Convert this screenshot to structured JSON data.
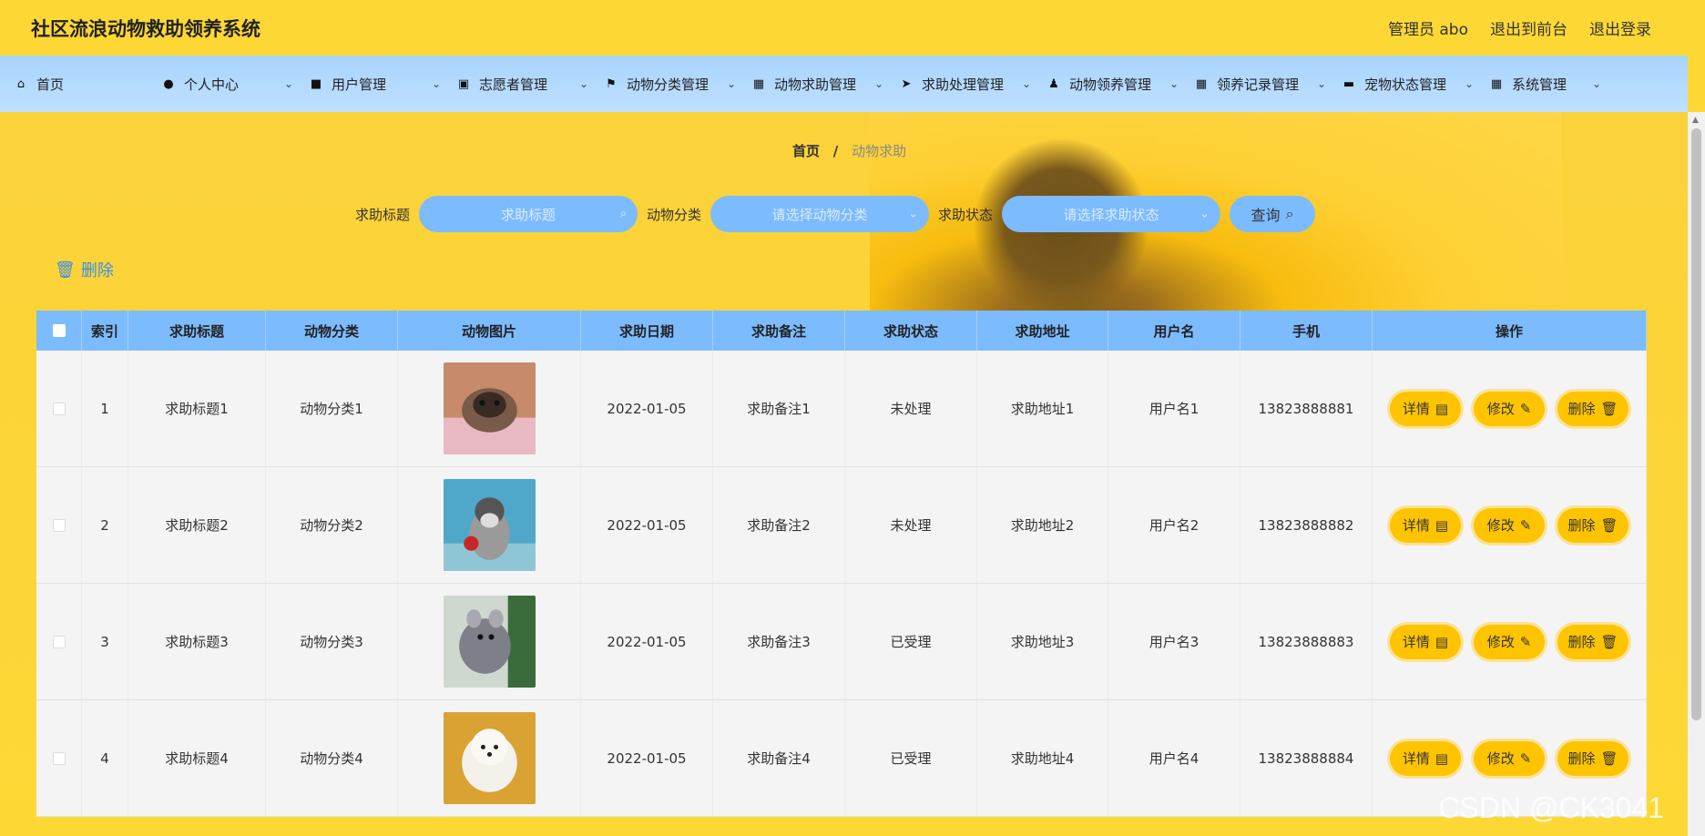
{
  "app": {
    "title": "社区流浪动物救助领养系统",
    "admin": "管理员 abo",
    "to_front": "退出到前台",
    "logout": "退出登录"
  },
  "nav": [
    {
      "label": "首页",
      "icon": "home-icon",
      "chevron": false
    },
    {
      "label": "个人中心",
      "icon": "user-icon",
      "chevron": true
    },
    {
      "label": "用户管理",
      "icon": "wallet-icon",
      "chevron": true
    },
    {
      "label": "志愿者管理",
      "icon": "badge-icon",
      "chevron": true
    },
    {
      "label": "动物分类管理",
      "icon": "flag-icon",
      "chevron": true
    },
    {
      "label": "动物求助管理",
      "icon": "grid-icon",
      "chevron": true
    },
    {
      "label": "求助处理管理",
      "icon": "send-icon",
      "chevron": true
    },
    {
      "label": "动物领养管理",
      "icon": "person-icon",
      "chevron": true
    },
    {
      "label": "领养记录管理",
      "icon": "grid-icon",
      "chevron": true
    },
    {
      "label": "宠物状态管理",
      "icon": "briefcase-icon",
      "chevron": true
    },
    {
      "label": "系统管理",
      "icon": "grid-icon",
      "chevron": true
    }
  ],
  "breadcrumb": {
    "home": "首页",
    "sep": "/",
    "current": "动物求助"
  },
  "search": {
    "title_label": "求助标题",
    "title_placeholder": "求助标题",
    "category_label": "动物分类",
    "category_placeholder": "请选择动物分类",
    "status_label": "求助状态",
    "status_placeholder": "请选择求助状态",
    "query_label": "查询"
  },
  "toolbar": {
    "delete_label": "删除"
  },
  "table": {
    "headers": [
      "索引",
      "求助标题",
      "动物分类",
      "动物图片",
      "求助日期",
      "求助备注",
      "求助状态",
      "求助地址",
      "用户名",
      "手机",
      "操作"
    ],
    "rows": [
      {
        "index": "1",
        "title": "求助标题1",
        "category": "动物分类1",
        "image": "pug",
        "date": "2022-01-05",
        "note": "求助备注1",
        "status": "未处理",
        "address": "求助地址1",
        "user": "用户名1",
        "phone": "13823888881"
      },
      {
        "index": "2",
        "title": "求助标题2",
        "category": "动物分类2",
        "image": "schnauzer",
        "date": "2022-01-05",
        "note": "求助备注2",
        "status": "未处理",
        "address": "求助地址2",
        "user": "用户名2",
        "phone": "13823888882"
      },
      {
        "index": "3",
        "title": "求助标题3",
        "category": "动物分类3",
        "image": "chinchilla",
        "date": "2022-01-05",
        "note": "求助备注3",
        "status": "已受理",
        "address": "求助地址3",
        "user": "用户名3",
        "phone": "13823888883"
      },
      {
        "index": "4",
        "title": "求助标题4",
        "category": "动物分类4",
        "image": "poodle",
        "date": "2022-01-05",
        "note": "求助备注4",
        "status": "已受理",
        "address": "求助地址4",
        "user": "用户名4",
        "phone": "13823888884"
      }
    ],
    "actions": {
      "detail": "详情",
      "edit": "修改",
      "delete": "删除"
    }
  },
  "watermark": "CSDN @CK3041",
  "colors": {
    "header": "#fdd835",
    "nav": "#b3dbff",
    "accent": "#7dbbff",
    "action": "#ffc400"
  }
}
